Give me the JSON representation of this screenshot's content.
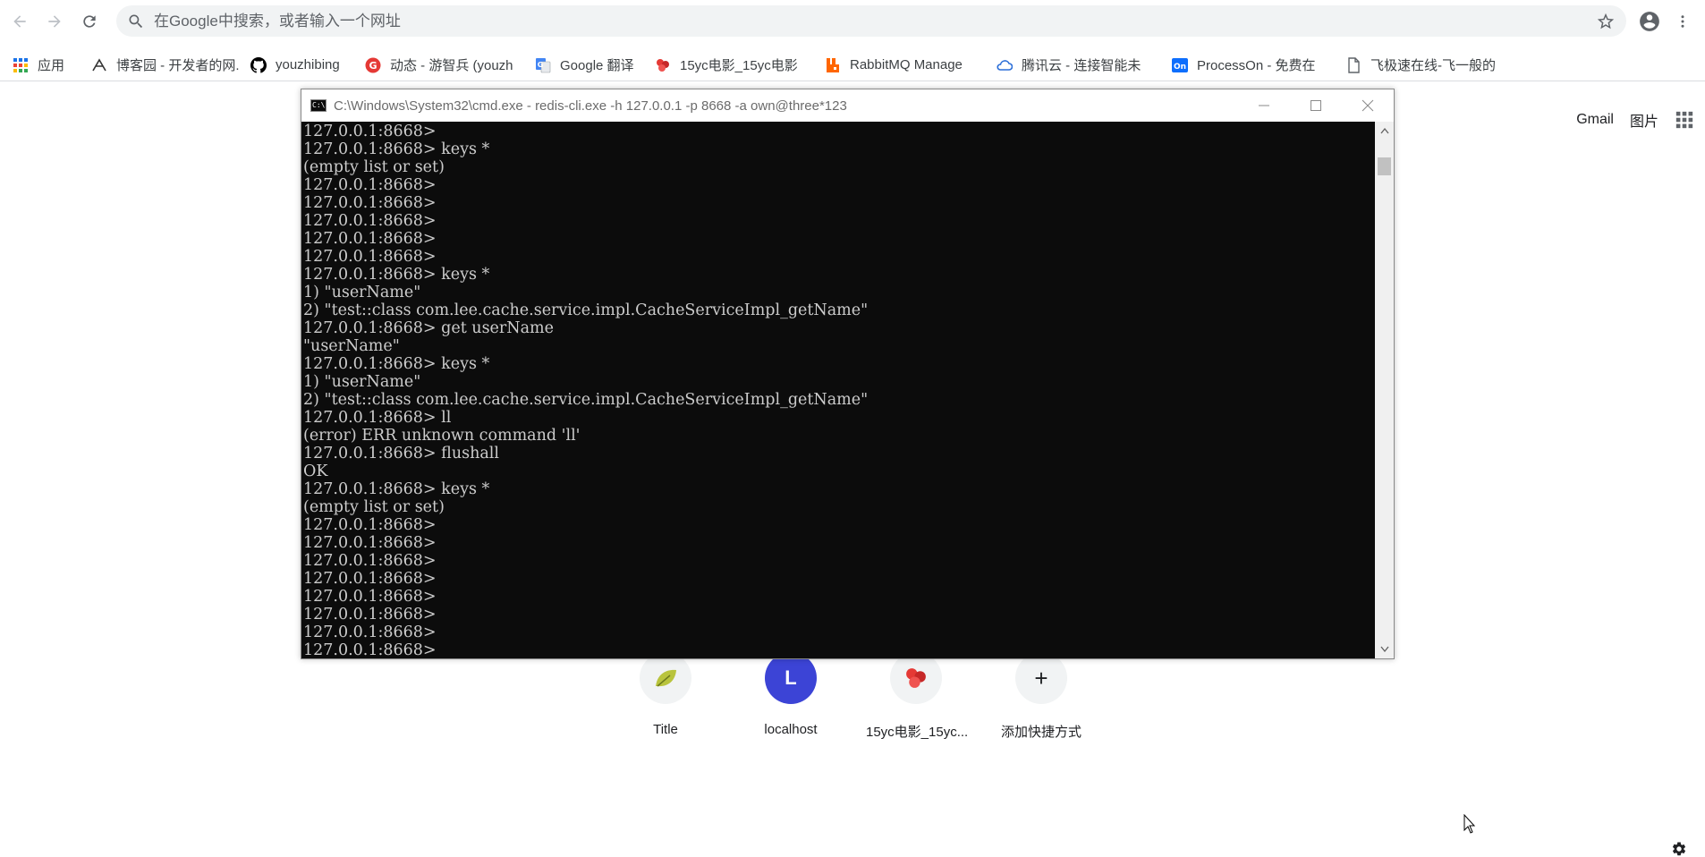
{
  "toolbar": {
    "omnibox_placeholder": "在Google中搜索，或者输入一个网址"
  },
  "bookmarks": [
    {
      "label": "应用",
      "icon": "apps-grid-icon",
      "color": "#1a73e8"
    },
    {
      "label": "博客园 - 开发者的网...",
      "icon": "cnblogs-icon",
      "color": "#333333"
    },
    {
      "label": "youzhibing",
      "icon": "github-icon",
      "color": "#000000"
    },
    {
      "label": "动态 - 游智兵 (youzh",
      "icon": "gitee-icon",
      "color": "#e53935"
    },
    {
      "label": "Google 翻译",
      "icon": "google-translate-icon",
      "color": "#4285f4"
    },
    {
      "label": "15yc电影_15yc电影",
      "icon": "film-icon",
      "color": "#e53935"
    },
    {
      "label": "RabbitMQ Manage",
      "icon": "rabbitmq-icon",
      "color": "#ff6600"
    },
    {
      "label": "腾讯云 - 连接智能未",
      "icon": "tencent-cloud-icon",
      "color": "#2b6ed8"
    },
    {
      "label": "ProcessOn - 免费在",
      "icon": "processon-icon",
      "color": "#0d6efd"
    },
    {
      "label": "飞极速在线-飞一般的",
      "icon": "page-icon",
      "color": "#5f6368"
    }
  ],
  "ntp": {
    "gmail": "Gmail",
    "images": "图片",
    "shortcuts": [
      {
        "label": "Title",
        "tile_text": "",
        "icon": "leaf-icon",
        "tile_color": "#f1f3f4"
      },
      {
        "label": "localhost",
        "tile_text": "L",
        "icon": "letter-avatar-icon",
        "tile_color": "#3c44d6"
      },
      {
        "label": "15yc电影_15yc...",
        "tile_text": "",
        "icon": "film-icon",
        "tile_color": "#f1f3f4"
      },
      {
        "label": "添加快捷方式",
        "tile_text": "+",
        "icon": "add-icon",
        "tile_color": "#f1f3f4"
      }
    ]
  },
  "cmd": {
    "title": "C:\\Windows\\System32\\cmd.exe - redis-cli.exe  -h 127.0.0.1 -p 8668 -a own@three*123",
    "icon_text": "C:\\.",
    "output": "127.0.0.1:8668>\n127.0.0.1:8668> keys *\n(empty list or set)\n127.0.0.1:8668>\n127.0.0.1:8668>\n127.0.0.1:8668>\n127.0.0.1:8668>\n127.0.0.1:8668>\n127.0.0.1:8668> keys *\n1) \"userName\"\n2) \"test::class com.lee.cache.service.impl.CacheServiceImpl_getName\"\n127.0.0.1:8668> get userName\n\"userName\"\n127.0.0.1:8668> keys *\n1) \"userName\"\n2) \"test::class com.lee.cache.service.impl.CacheServiceImpl_getName\"\n127.0.0.1:8668> ll\n(error) ERR unknown command 'll'\n127.0.0.1:8668> flushall\nOK\n127.0.0.1:8668> keys *\n(empty list or set)\n127.0.0.1:8668>\n127.0.0.1:8668>\n127.0.0.1:8668>\n127.0.0.1:8668>\n127.0.0.1:8668>\n127.0.0.1:8668>\n127.0.0.1:8668>\n127.0.0.1:8668>"
  }
}
